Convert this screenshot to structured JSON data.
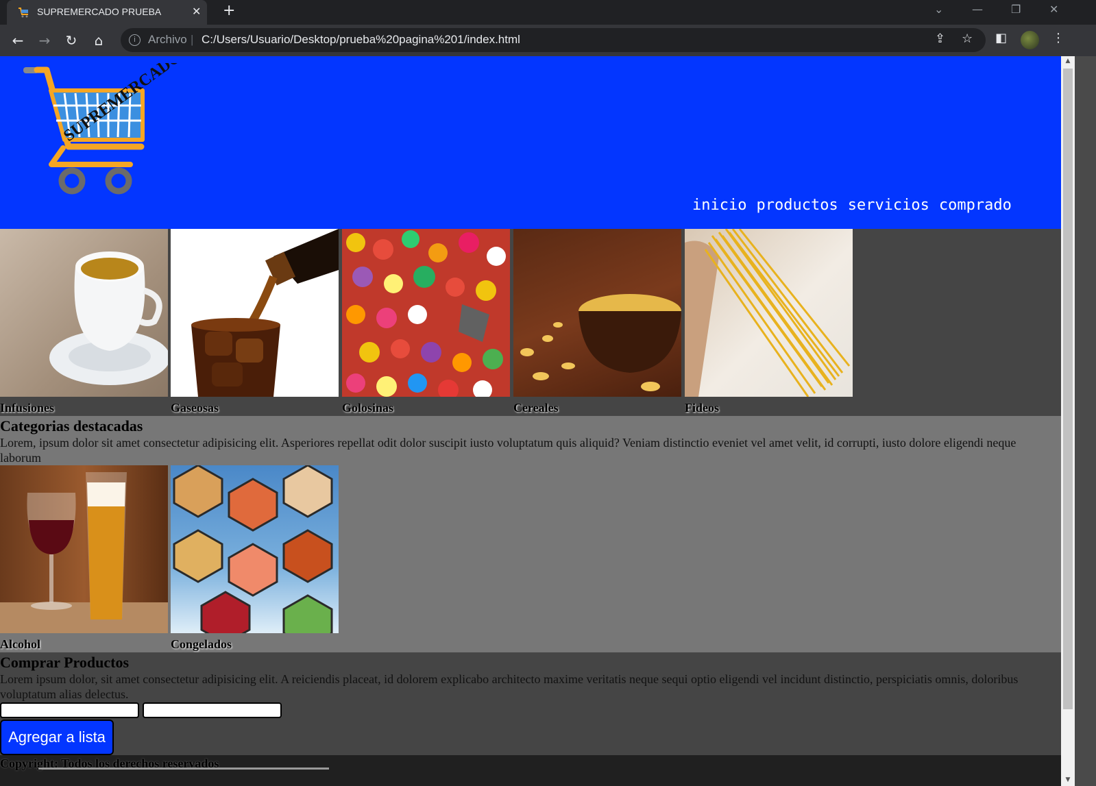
{
  "browser": {
    "tab_title": "SUPREMERCADO PRUEBA",
    "url_scheme": "Archivo",
    "url": "C:/Users/Usuario/Desktop/prueba%20pagina%201/index.html"
  },
  "header": {
    "logo_text": "SUPREMERCADO",
    "nav": [
      "inicio",
      "productos",
      "servicios",
      "comprado"
    ]
  },
  "section1": {
    "items": [
      {
        "label": "Infusiones",
        "image": "tea-cup"
      },
      {
        "label": "Gaseosas",
        "image": "cola-glass"
      },
      {
        "label": "Golosinas",
        "image": "candies"
      },
      {
        "label": "Cereales",
        "image": "cereal-bowl"
      },
      {
        "label": "Fideos",
        "image": "spaghetti"
      }
    ]
  },
  "section2": {
    "title": "Categorias destacadas",
    "text": "Lorem, ipsum dolor sit amet consectetur adipisicing elit. Asperiores repellat odit dolor suscipit iusto voluptatum quis aliquid? Veniam distinctio eveniet vel amet velit, id corrupti, iusto dolore eligendi neque laborum",
    "items": [
      {
        "label": "Alcohol",
        "image": "wine-beer"
      },
      {
        "label": "Congelados",
        "image": "frozen-food"
      }
    ]
  },
  "section3": {
    "title": "Comprar Productos",
    "text": "Lorem ipsum dolor, sit amet consectetur adipisicing elit. A reiciendis placeat, id dolorem explicabo architecto maxime veritatis neque sequi optio eligendi vel incidunt distinctio, perspiciatis omnis, doloribus voluptatum alias delectus.",
    "input1_value": "",
    "input2_value": "",
    "button_label": "Agregar a lista"
  },
  "footer": {
    "copyright": "Copyright: Todos los derechos reservados"
  },
  "colors": {
    "header_bg": "#0336ff",
    "button_bg": "#0336ff"
  }
}
